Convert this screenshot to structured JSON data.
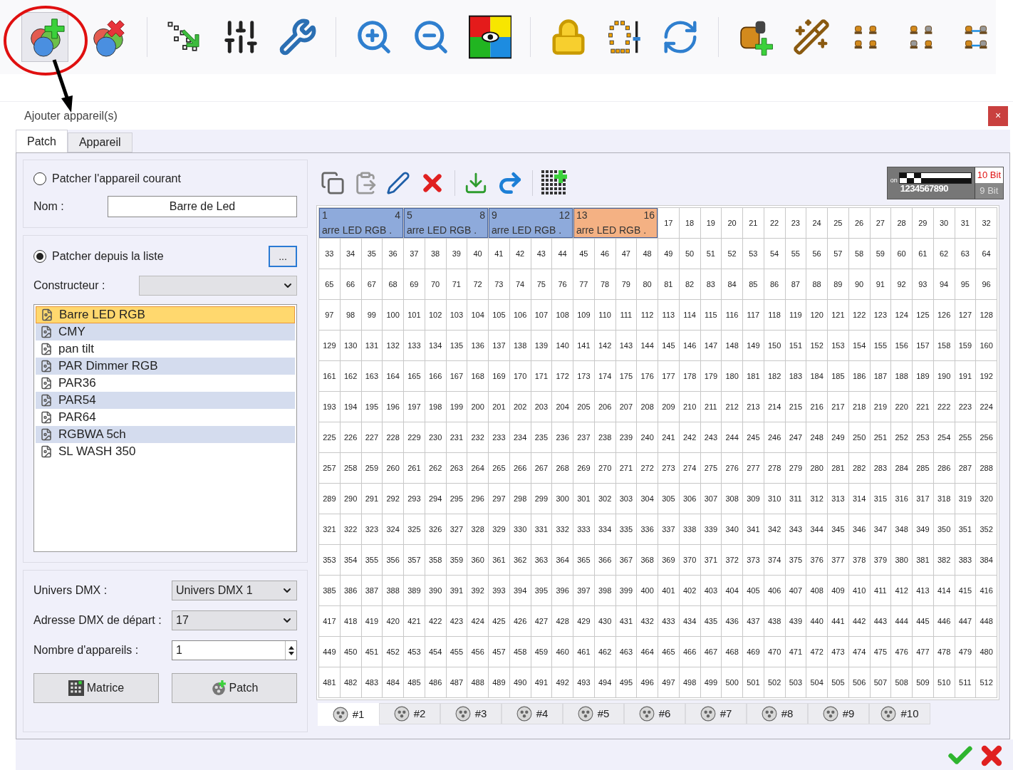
{
  "dialog": {
    "title": "Ajouter appareil(s)",
    "close": "×"
  },
  "tabs": [
    {
      "label": "Patch",
      "selected": true
    },
    {
      "label": "Appareil",
      "selected": false
    }
  ],
  "current": {
    "label": "Patcher l'appareil courant",
    "selected": false,
    "name_label": "Nom :",
    "name_value": "Barre de Led"
  },
  "from_list": {
    "label": "Patcher depuis la liste",
    "selected": true,
    "browse": "...",
    "maker_label": "Constructeur :"
  },
  "fixtures": [
    {
      "name": "Barre LED RGB",
      "selected": true
    },
    {
      "name": "CMY",
      "selected": false
    },
    {
      "name": "pan tilt",
      "selected": false
    },
    {
      "name": "PAR Dimmer RGB",
      "selected": false
    },
    {
      "name": "PAR36",
      "selected": false
    },
    {
      "name": "PAR54",
      "selected": false
    },
    {
      "name": "PAR64",
      "selected": false
    },
    {
      "name": "RGBWA 5ch",
      "selected": false
    },
    {
      "name": "SL WASH 350",
      "selected": false
    }
  ],
  "settings": [
    {
      "label": "Univers DMX :",
      "value": "Univers DMX 1",
      "kind": "select"
    },
    {
      "label": "Adresse DMX de départ :",
      "value": "17",
      "kind": "select"
    },
    {
      "label": "Nombre d'appareils :",
      "value": "1",
      "kind": "spin"
    }
  ],
  "actions": [
    {
      "label": "Matrice",
      "kind": "matrix"
    },
    {
      "label": "Patch",
      "kind": "patch"
    }
  ],
  "dip": {
    "on_label": "on",
    "switches": [
      true,
      false,
      true,
      false,
      false,
      false,
      false,
      false,
      false,
      false
    ],
    "digits": "1234567890",
    "bits": [
      {
        "label": "10 Bit",
        "selected": true
      },
      {
        "label": "9 Bit",
        "selected": false
      }
    ]
  },
  "patches": [
    {
      "start": "1",
      "end": "4",
      "label": "arre LED RGB .",
      "color": "#8eaadb"
    },
    {
      "start": "5",
      "end": "8",
      "label": "arre LED RGB .",
      "color": "#8eaadb"
    },
    {
      "start": "9",
      "end": "12",
      "label": "arre LED RGB .",
      "color": "#8eaadb"
    },
    {
      "start": "13",
      "end": "16",
      "label": "arre LED RGB .",
      "color": "#f4b183"
    }
  ],
  "first_row": [
    "17",
    "18",
    "19",
    "20",
    "21",
    "22",
    "23",
    "24",
    "25",
    "26",
    "27",
    "28",
    "29",
    "30",
    "31",
    "32"
  ],
  "rows": [
    [
      "33",
      "34",
      "35",
      "36",
      "37",
      "38",
      "39",
      "40",
      "41",
      "42",
      "43",
      "44",
      "45",
      "46",
      "47",
      "48",
      "49",
      "50",
      "51",
      "52",
      "53",
      "54",
      "55",
      "56",
      "57",
      "58",
      "59",
      "60",
      "61",
      "62",
      "63",
      "64"
    ],
    [
      "65",
      "66",
      "67",
      "68",
      "69",
      "70",
      "71",
      "72",
      "73",
      "74",
      "75",
      "76",
      "77",
      "78",
      "79",
      "80",
      "81",
      "82",
      "83",
      "84",
      "85",
      "86",
      "87",
      "88",
      "89",
      "90",
      "91",
      "92",
      "93",
      "94",
      "95",
      "96"
    ],
    [
      "97",
      "98",
      "99",
      "100",
      "101",
      "102",
      "103",
      "104",
      "105",
      "106",
      "107",
      "108",
      "109",
      "110",
      "111",
      "112",
      "113",
      "114",
      "115",
      "116",
      "117",
      "118",
      "119",
      "120",
      "121",
      "122",
      "123",
      "124",
      "125",
      "126",
      "127",
      "128"
    ],
    [
      "129",
      "130",
      "131",
      "132",
      "133",
      "134",
      "135",
      "136",
      "137",
      "138",
      "139",
      "140",
      "141",
      "142",
      "143",
      "144",
      "145",
      "146",
      "147",
      "148",
      "149",
      "150",
      "151",
      "152",
      "153",
      "154",
      "155",
      "156",
      "157",
      "158",
      "159",
      "160"
    ],
    [
      "161",
      "162",
      "163",
      "164",
      "165",
      "166",
      "167",
      "168",
      "169",
      "170",
      "171",
      "172",
      "173",
      "174",
      "175",
      "176",
      "177",
      "178",
      "179",
      "180",
      "181",
      "182",
      "183",
      "184",
      "185",
      "186",
      "187",
      "188",
      "189",
      "190",
      "191",
      "192"
    ],
    [
      "193",
      "194",
      "195",
      "196",
      "197",
      "198",
      "199",
      "200",
      "201",
      "202",
      "203",
      "204",
      "205",
      "206",
      "207",
      "208",
      "209",
      "210",
      "211",
      "212",
      "213",
      "214",
      "215",
      "216",
      "217",
      "218",
      "219",
      "220",
      "221",
      "222",
      "223",
      "224"
    ],
    [
      "225",
      "226",
      "227",
      "228",
      "229",
      "230",
      "231",
      "232",
      "233",
      "234",
      "235",
      "236",
      "237",
      "238",
      "239",
      "240",
      "241",
      "242",
      "243",
      "244",
      "245",
      "246",
      "247",
      "248",
      "249",
      "250",
      "251",
      "252",
      "253",
      "254",
      "255",
      "256"
    ],
    [
      "257",
      "258",
      "259",
      "260",
      "261",
      "262",
      "263",
      "264",
      "265",
      "266",
      "267",
      "268",
      "269",
      "270",
      "271",
      "272",
      "273",
      "274",
      "275",
      "276",
      "277",
      "278",
      "279",
      "280",
      "281",
      "282",
      "283",
      "284",
      "285",
      "286",
      "287",
      "288"
    ],
    [
      "289",
      "290",
      "291",
      "292",
      "293",
      "294",
      "295",
      "296",
      "297",
      "298",
      "299",
      "300",
      "301",
      "302",
      "303",
      "304",
      "305",
      "306",
      "307",
      "308",
      "309",
      "310",
      "311",
      "312",
      "313",
      "314",
      "315",
      "316",
      "317",
      "318",
      "319",
      "320"
    ],
    [
      "321",
      "322",
      "323",
      "324",
      "325",
      "326",
      "327",
      "328",
      "329",
      "330",
      "331",
      "332",
      "333",
      "334",
      "335",
      "336",
      "337",
      "338",
      "339",
      "340",
      "341",
      "342",
      "343",
      "344",
      "345",
      "346",
      "347",
      "348",
      "349",
      "350",
      "351",
      "352"
    ],
    [
      "353",
      "354",
      "355",
      "356",
      "357",
      "358",
      "359",
      "360",
      "361",
      "362",
      "363",
      "364",
      "365",
      "366",
      "367",
      "368",
      "369",
      "370",
      "371",
      "372",
      "373",
      "374",
      "375",
      "376",
      "377",
      "378",
      "379",
      "380",
      "381",
      "382",
      "383",
      "384"
    ],
    [
      "385",
      "386",
      "387",
      "388",
      "389",
      "390",
      "391",
      "392",
      "393",
      "394",
      "395",
      "396",
      "397",
      "398",
      "399",
      "400",
      "401",
      "402",
      "403",
      "404",
      "405",
      "406",
      "407",
      "408",
      "409",
      "410",
      "411",
      "412",
      "413",
      "414",
      "415",
      "416"
    ],
    [
      "417",
      "418",
      "419",
      "420",
      "421",
      "422",
      "423",
      "424",
      "425",
      "426",
      "427",
      "428",
      "429",
      "430",
      "431",
      "432",
      "433",
      "434",
      "435",
      "436",
      "437",
      "438",
      "439",
      "440",
      "441",
      "442",
      "443",
      "444",
      "445",
      "446",
      "447",
      "448"
    ],
    [
      "449",
      "450",
      "451",
      "452",
      "453",
      "454",
      "455",
      "456",
      "457",
      "458",
      "459",
      "460",
      "461",
      "462",
      "463",
      "464",
      "465",
      "466",
      "467",
      "468",
      "469",
      "470",
      "471",
      "472",
      "473",
      "474",
      "475",
      "476",
      "477",
      "478",
      "479",
      "480"
    ],
    [
      "481",
      "482",
      "483",
      "484",
      "485",
      "486",
      "487",
      "488",
      "489",
      "490",
      "491",
      "492",
      "493",
      "494",
      "495",
      "496",
      "497",
      "498",
      "499",
      "500",
      "501",
      "502",
      "503",
      "504",
      "505",
      "506",
      "507",
      "508",
      "509",
      "510",
      "511",
      "512"
    ]
  ],
  "universes": [
    {
      "label": "#1",
      "selected": true
    },
    {
      "label": "#2",
      "selected": false
    },
    {
      "label": "#3",
      "selected": false
    },
    {
      "label": "#4",
      "selected": false
    },
    {
      "label": "#5",
      "selected": false
    },
    {
      "label": "#6",
      "selected": false
    },
    {
      "label": "#7",
      "selected": false
    },
    {
      "label": "#8",
      "selected": false
    },
    {
      "label": "#9",
      "selected": false
    },
    {
      "label": "#10",
      "selected": false
    }
  ]
}
